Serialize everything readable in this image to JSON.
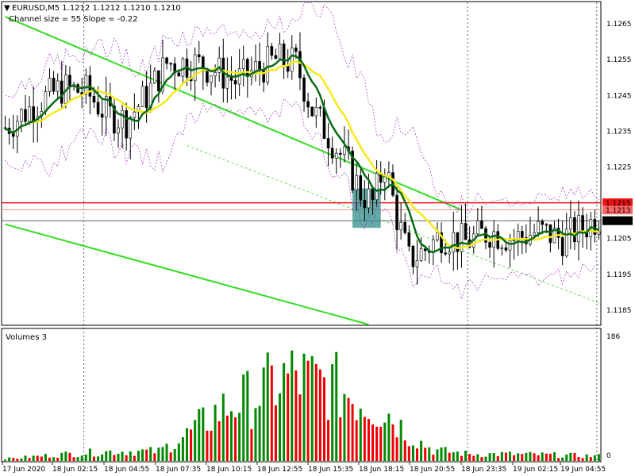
{
  "header": {
    "symbol_line": "EURUSD,M5  1.1212 1.1212 1.1210 1.1210",
    "channel_line": "Channel size = 55 Slope = -0.22"
  },
  "volume_panel": {
    "title": "Volumes 3",
    "max_label": "186",
    "zero_label": "0"
  },
  "price_axis": {
    "ticks": [
      "1.1265",
      "1.1255",
      "1.1245",
      "1.1235",
      "1.1225",
      "1.1205",
      "1.1195",
      "1.1185"
    ]
  },
  "price_tags": [
    {
      "label": "1.1215",
      "value": 1.1215,
      "bg": "#ee1111",
      "fg": "#ffffff",
      "line": true
    },
    {
      "label": "1.1213",
      "value": 1.1213,
      "bg": "#ff6666",
      "fg": "#ffffff",
      "line": true
    },
    {
      "label": "1.1210",
      "value": 1.121,
      "bg": "#000000",
      "fg": "#ffffff",
      "line": true
    }
  ],
  "time_axis": {
    "labels": [
      "17 Jun 2020",
      "18 Jun 02:15",
      "18 Jun 04:55",
      "18 Jun 07:35",
      "18 Jun 10:15",
      "18 Jun 12:55",
      "18 Jun 15:35",
      "18 Jun 18:15",
      "18 Jun 20:55",
      "18 Jun 23:35",
      "19 Jun 02:15",
      "19 Jun 04:55"
    ]
  },
  "colors": {
    "candle": "#000000",
    "ma_fast": "#0b6b16",
    "ma_slow": "#f4ea1a",
    "envelope": "#a030c0",
    "channel": "#33dd22",
    "volume_up": "#008800",
    "volume_down": "#ee0000",
    "highlight_box": "#2f8f8a"
  },
  "chart_data": {
    "type": "candlestick",
    "title": "EURUSD,M5",
    "ylim": [
      1.1181,
      1.1271
    ],
    "volume_ylim": [
      0,
      186
    ],
    "channel": {
      "upper": [
        [
          0,
          1.1267
        ],
        [
          113,
          1.1213
        ]
      ],
      "lower": [
        [
          0,
          1.1209
        ],
        [
          90,
          1.1181
        ]
      ],
      "mid": [
        [
          45,
          1.1231
        ],
        [
          147,
          1.1187
        ]
      ]
    },
    "price_anchors": [
      [
        0,
        1.1236
      ],
      [
        8,
        1.1243
      ],
      [
        14,
        1.1247
      ],
      [
        20,
        1.1246
      ],
      [
        25,
        1.124
      ],
      [
        30,
        1.1238
      ],
      [
        35,
        1.1245
      ],
      [
        40,
        1.1254
      ],
      [
        47,
        1.1254
      ],
      [
        52,
        1.1252
      ],
      [
        57,
        1.1249
      ],
      [
        62,
        1.1252
      ],
      [
        67,
        1.1255
      ],
      [
        72,
        1.1254
      ],
      [
        76,
        1.1241
      ],
      [
        80,
        1.1234
      ],
      [
        85,
        1.1225
      ],
      [
        88,
        1.1218
      ],
      [
        91,
        1.1215
      ],
      [
        94,
        1.1226
      ],
      [
        97,
        1.1211
      ],
      [
        100,
        1.1199
      ],
      [
        103,
        1.1201
      ],
      [
        108,
        1.1206
      ],
      [
        114,
        1.1204
      ],
      [
        120,
        1.1207
      ],
      [
        126,
        1.1205
      ],
      [
        132,
        1.1207
      ],
      [
        138,
        1.1205
      ],
      [
        143,
        1.1208
      ],
      [
        147,
        1.1211
      ]
    ],
    "volume_anchors": [
      [
        0,
        3
      ],
      [
        15,
        10
      ],
      [
        27,
        14
      ],
      [
        38,
        14
      ],
      [
        45,
        38
      ],
      [
        52,
        70
      ],
      [
        57,
        85
      ],
      [
        62,
        95
      ],
      [
        67,
        115
      ],
      [
        72,
        125
      ],
      [
        76,
        115
      ],
      [
        81,
        110
      ],
      [
        86,
        95
      ],
      [
        91,
        80
      ],
      [
        95,
        70
      ],
      [
        100,
        38
      ],
      [
        106,
        16
      ],
      [
        115,
        10
      ],
      [
        124,
        10
      ],
      [
        133,
        9
      ],
      [
        147,
        7
      ]
    ]
  }
}
